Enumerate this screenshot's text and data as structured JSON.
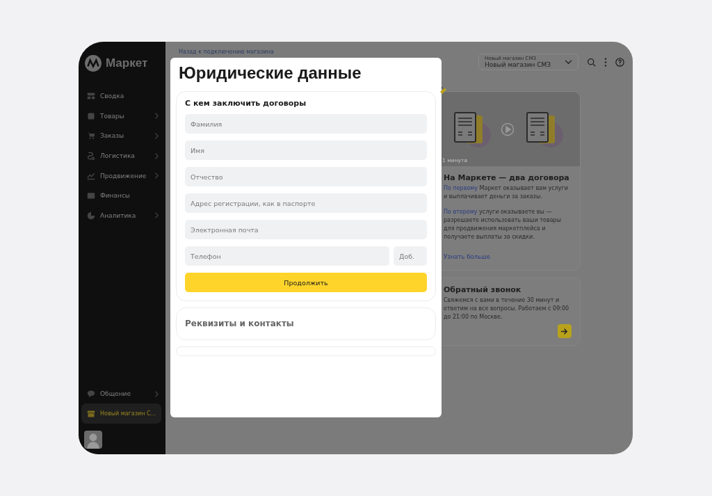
{
  "sidebar": {
    "logo": "Маркет",
    "items": [
      {
        "label": "Сводка",
        "chevron": false
      },
      {
        "label": "Товары",
        "chevron": true
      },
      {
        "label": "Заказы",
        "chevron": true
      },
      {
        "label": "Логистика",
        "chevron": true
      },
      {
        "label": "Продвижение",
        "chevron": true
      },
      {
        "label": "Финансы",
        "chevron": false
      },
      {
        "label": "Аналитика",
        "chevron": true
      }
    ],
    "bottom_items": [
      {
        "label": "Общение",
        "chevron": true,
        "selected": false
      },
      {
        "label": "Новый магазин С...",
        "chevron": false,
        "selected": true
      }
    ]
  },
  "header": {
    "back_link": "Назад к подключению магазина",
    "store_select": {
      "label": "Новый магазин СМЗ",
      "value": "Новый магазин СМЗ"
    }
  },
  "video_card": {
    "duration": "1 минута"
  },
  "info_card": {
    "title": "На Маркете — два договора",
    "paragraphs": [
      {
        "link": "По первому",
        "text": " Маркет оказывает вам услуги и выплачивает деньги за заказы."
      },
      {
        "link": "По второму",
        "text": " услуги оказываете вы — разрешаете использовать ваши товары для продвижения маркетплейса и получаете выплаты за скидки."
      }
    ],
    "more_link": "Узнать больше"
  },
  "callback_card": {
    "title": "Обратный звонок",
    "text": "Свяжемся с вами в течение 30 минут и ответим на все вопросы. Работаем с 09:00 до 21:00 по Москве."
  },
  "modal": {
    "title": "Юридические данные",
    "sections": [
      {
        "title": "С кем заключить договоры",
        "expanded": true,
        "fields": [
          {
            "placeholder": "Фамилия"
          },
          {
            "placeholder": "Имя"
          },
          {
            "placeholder": "Отчество"
          },
          {
            "placeholder": "Адрес регистрации, как в паспорте"
          },
          {
            "placeholder": "Электронная почта"
          }
        ],
        "phone": {
          "placeholder": "Телефон",
          "ext_placeholder": "Доб."
        },
        "button": "Продолжить"
      },
      {
        "title": "Реквизиты и контакты",
        "expanded": false
      }
    ]
  }
}
